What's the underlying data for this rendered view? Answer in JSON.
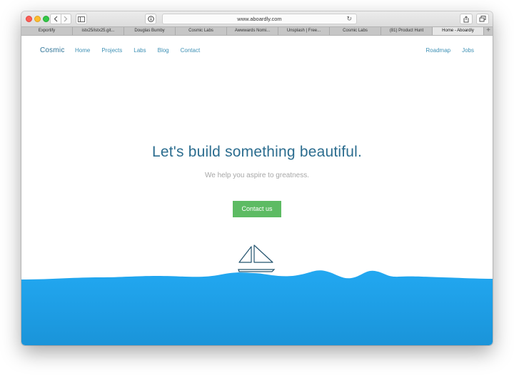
{
  "browser": {
    "url": "www.aboardly.com",
    "tabs": [
      "Exportify",
      "istx25/istx25.git...",
      "Douglas Bumby",
      "Cosmic Labs",
      "Awwwards Nomi...",
      "Unsplash | Free...",
      "Cosmic Labs",
      "(81) Product Hunt",
      "Home - Aboardly"
    ],
    "add_tab": "+"
  },
  "site": {
    "logo": "Cosmic",
    "nav": {
      "home": "Home",
      "projects": "Projects",
      "labs": "Labs",
      "blog": "Blog",
      "contact": "Contact",
      "roadmap": "Roadmap",
      "jobs": "Jobs"
    },
    "hero": {
      "title": "Let's build something beautiful.",
      "subtitle": "We help you aspire to greatness.",
      "cta": "Contact us"
    }
  },
  "colors": {
    "accent": "#2c6d8f",
    "link": "#3f91b5",
    "cta": "#5dbb63",
    "sea": "#1ea5ee"
  },
  "icons": [
    "back-icon",
    "forward-icon",
    "sidebar-icon",
    "info-icon",
    "reload-icon",
    "share-icon",
    "tabs-overview-icon",
    "sailboat-icon"
  ]
}
